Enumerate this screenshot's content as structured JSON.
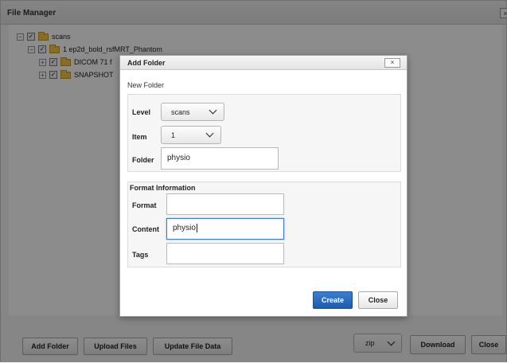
{
  "file_manager": {
    "title": "File Manager",
    "close_glyph": "×",
    "tree": [
      {
        "label": "scans",
        "expander": "−"
      },
      {
        "label": "1 ep2d_bold_rsfMRT_Phantom",
        "expander": "−"
      },
      {
        "label": "DICOM 71 f",
        "expander": "+"
      },
      {
        "label": "SNAPSHOT",
        "expander": "+"
      }
    ],
    "buttons": {
      "add_folder": "Add Folder",
      "upload_files": "Upload Files",
      "update_file_data": "Update File Data",
      "format_select": "zip",
      "download": "Download",
      "close": "Close"
    }
  },
  "dialog": {
    "title": "Add Folder",
    "close_glyph": "×",
    "subtitle": "New Folder",
    "level_label": "Level",
    "level_value": "scans",
    "item_label": "Item",
    "item_value": "1",
    "folder_label": "Folder",
    "folder_value": "physio",
    "format_info_heading": "Format Information",
    "format_label": "Format",
    "format_value": "",
    "content_label": "Content",
    "content_value": "physio",
    "tags_label": "Tags",
    "tags_value": "",
    "create_label": "Create",
    "close_label": "Close"
  },
  "colors": {
    "primary_button": "#1d5cad",
    "focus_border": "#3a7bd5",
    "folder_icon": "#f2c94c",
    "overlay": "rgba(0,0,0,0.45)"
  }
}
